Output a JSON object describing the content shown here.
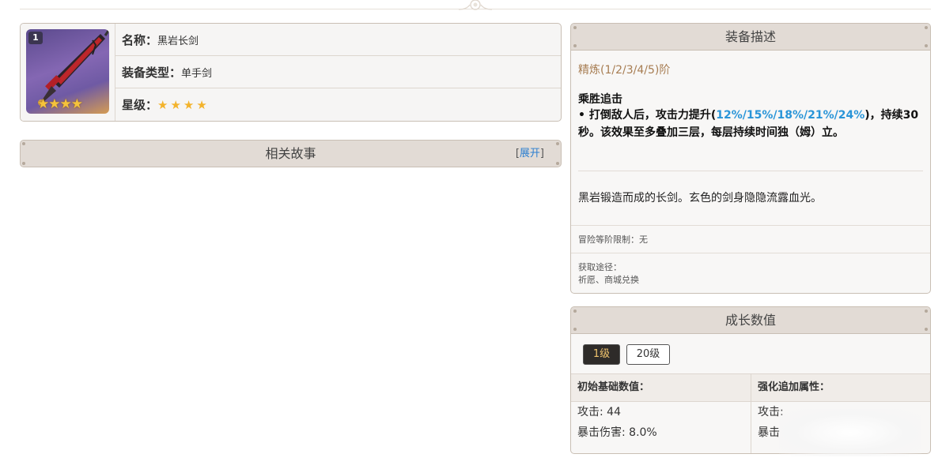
{
  "weapon": {
    "refine_badge": "1",
    "name_label": "名称：",
    "name_value": "黑岩长剑",
    "type_label": "装备类型：",
    "type_value": "单手剑",
    "star_label": "星级：",
    "star_rating": 4,
    "star_glyph": "★",
    "portrait_stars": "★★★★"
  },
  "story": {
    "title": "相关故事",
    "expand_open": "[",
    "expand_label": "展开",
    "expand_close": "]"
  },
  "description": {
    "title": "装备描述",
    "refine_title": "精炼(1/2/3/4/5)阶",
    "skill_name": "乘胜追击",
    "skill_text_prefix": "• 打倒敌人后，攻击力提升(",
    "skill_values": "12%/15%/18%/21%/24%",
    "skill_text_suffix": ")，持续30秒。该效果至多叠加三层，每层持续时间独（姆）立。",
    "flavor": "黑岩锻造而成的长剑。玄色的剑身隐隐流露血光。",
    "ar_limit": "冒险等阶限制：无",
    "obtain_label": "获取途径：",
    "obtain_value": "祈愿、商城兑换"
  },
  "growth": {
    "title": "成长数值",
    "levels": [
      "1级",
      "20级"
    ],
    "selected_level": "1级",
    "base_header": "初始基础数值：",
    "bonus_header": "强化追加属性：",
    "base_stats": [
      "攻击: 44",
      "暴击伤害: 8.0%"
    ],
    "bonus_stats": [
      "攻击:",
      "暴击"
    ]
  },
  "colors": {
    "header_bg": "#e2dbd5",
    "border": "#c9bfb4",
    "highlight_blue": "#2a95d8",
    "refine_gold": "#a77d52",
    "star_gold": "#f3b32c"
  }
}
